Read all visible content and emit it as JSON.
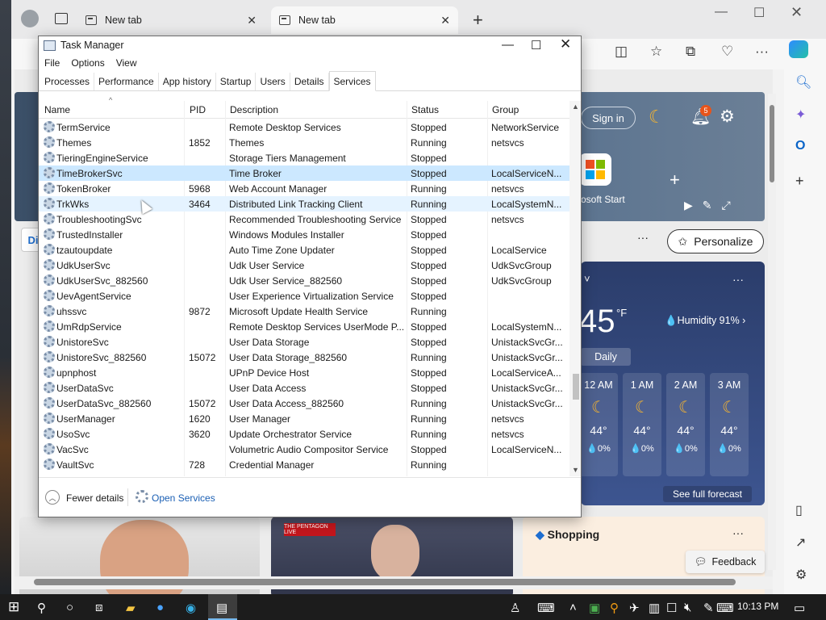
{
  "browser": {
    "tabs": [
      {
        "label": "New tab",
        "active": false
      },
      {
        "label": "New tab",
        "active": true
      }
    ],
    "new_tab_symbol": "+",
    "sign_in": "Sign in",
    "notification_count": "5",
    "ms_start": "rosoft Start",
    "di_tab": "Di",
    "personalize": "Personalize",
    "weather": {
      "temp": "45",
      "unit": "°F",
      "humidity": "Humidity 91%",
      "daily": "Daily",
      "hours": [
        {
          "time": "12 AM",
          "temp": "44°",
          "precip": "0%"
        },
        {
          "time": "1 AM",
          "temp": "44°",
          "precip": "0%"
        },
        {
          "time": "2 AM",
          "temp": "44°",
          "precip": "0%"
        },
        {
          "time": "3 AM",
          "temp": "44°",
          "precip": "0%"
        }
      ],
      "forecast_link": "See full forecast"
    },
    "news_badge": "THE PENTAGON LIVE",
    "shopping": "Shopping",
    "feedback": "Feedback",
    "colors": {
      "accent": "#1a5fb4",
      "selected_row": "#cce8ff",
      "edge_badge": "#e8541a"
    }
  },
  "taskmanager": {
    "title": "Task Manager",
    "menu": [
      "File",
      "Options",
      "View"
    ],
    "tabs": [
      "Processes",
      "Performance",
      "App history",
      "Startup",
      "Users",
      "Details",
      "Services"
    ],
    "selected_tab": "Services",
    "columns": [
      "Name",
      "PID",
      "Description",
      "Status",
      "Group"
    ],
    "rows": [
      {
        "name": "TermService",
        "pid": "",
        "desc": "Remote Desktop Services",
        "status": "Stopped",
        "group": "NetworkService"
      },
      {
        "name": "Themes",
        "pid": "1852",
        "desc": "Themes",
        "status": "Running",
        "group": "netsvcs"
      },
      {
        "name": "TieringEngineService",
        "pid": "",
        "desc": "Storage Tiers Management",
        "status": "Stopped",
        "group": ""
      },
      {
        "name": "TimeBrokerSvc",
        "pid": "",
        "desc": "Time Broker",
        "status": "Stopped",
        "group": "LocalServiceN..."
      },
      {
        "name": "TokenBroker",
        "pid": "5968",
        "desc": "Web Account Manager",
        "status": "Running",
        "group": "netsvcs"
      },
      {
        "name": "TrkWks",
        "pid": "3464",
        "desc": "Distributed Link Tracking Client",
        "status": "Running",
        "group": "LocalSystemN..."
      },
      {
        "name": "TroubleshootingSvc",
        "pid": "",
        "desc": "Recommended Troubleshooting Service",
        "status": "Stopped",
        "group": "netsvcs"
      },
      {
        "name": "TrustedInstaller",
        "pid": "",
        "desc": "Windows Modules Installer",
        "status": "Stopped",
        "group": ""
      },
      {
        "name": "tzautoupdate",
        "pid": "",
        "desc": "Auto Time Zone Updater",
        "status": "Stopped",
        "group": "LocalService"
      },
      {
        "name": "UdkUserSvc",
        "pid": "",
        "desc": "Udk User Service",
        "status": "Stopped",
        "group": "UdkSvcGroup"
      },
      {
        "name": "UdkUserSvc_882560",
        "pid": "",
        "desc": "Udk User Service_882560",
        "status": "Stopped",
        "group": "UdkSvcGroup"
      },
      {
        "name": "UevAgentService",
        "pid": "",
        "desc": "User Experience Virtualization Service",
        "status": "Stopped",
        "group": ""
      },
      {
        "name": "uhssvc",
        "pid": "9872",
        "desc": "Microsoft Update Health Service",
        "status": "Running",
        "group": ""
      },
      {
        "name": "UmRdpService",
        "pid": "",
        "desc": "Remote Desktop Services UserMode P...",
        "status": "Stopped",
        "group": "LocalSystemN..."
      },
      {
        "name": "UnistoreSvc",
        "pid": "",
        "desc": "User Data Storage",
        "status": "Stopped",
        "group": "UnistackSvcGr..."
      },
      {
        "name": "UnistoreSvc_882560",
        "pid": "15072",
        "desc": "User Data Storage_882560",
        "status": "Running",
        "group": "UnistackSvcGr..."
      },
      {
        "name": "upnphost",
        "pid": "",
        "desc": "UPnP Device Host",
        "status": "Stopped",
        "group": "LocalServiceA..."
      },
      {
        "name": "UserDataSvc",
        "pid": "",
        "desc": "User Data Access",
        "status": "Stopped",
        "group": "UnistackSvcGr..."
      },
      {
        "name": "UserDataSvc_882560",
        "pid": "15072",
        "desc": "User Data Access_882560",
        "status": "Running",
        "group": "UnistackSvcGr..."
      },
      {
        "name": "UserManager",
        "pid": "1620",
        "desc": "User Manager",
        "status": "Running",
        "group": "netsvcs"
      },
      {
        "name": "UsoSvc",
        "pid": "3620",
        "desc": "Update Orchestrator Service",
        "status": "Running",
        "group": "netsvcs"
      },
      {
        "name": "VacSvc",
        "pid": "",
        "desc": "Volumetric Audio Compositor Service",
        "status": "Stopped",
        "group": "LocalServiceN..."
      },
      {
        "name": "VaultSvc",
        "pid": "728",
        "desc": "Credential Manager",
        "status": "Running",
        "group": ""
      }
    ],
    "selected_row": "TimeBrokerSvc",
    "hovered_row": "TrkWks",
    "footer": {
      "fewer_details": "Fewer details",
      "open_services": "Open Services"
    }
  },
  "taskbar": {
    "time": "10:13 PM"
  }
}
